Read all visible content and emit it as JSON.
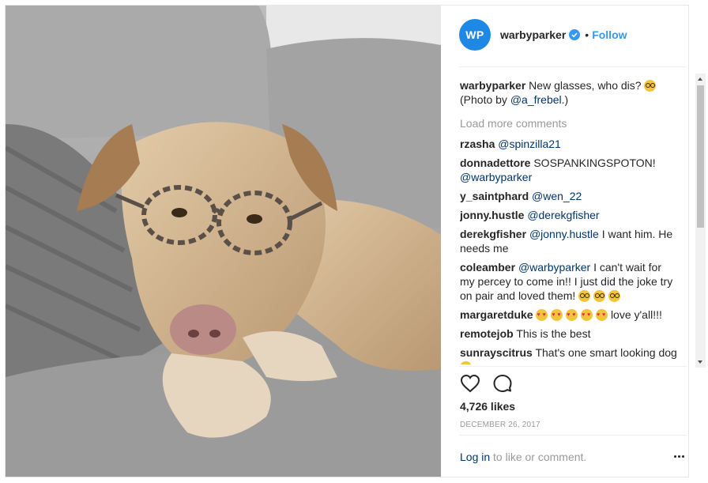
{
  "post": {
    "account": {
      "avatar_text": "WP",
      "username": "warbyparker",
      "verified": true,
      "separator": "•",
      "follow_label": "Follow"
    },
    "caption": {
      "user": "warbyparker",
      "text": "New glasses, who dis?",
      "emoji": "nerd-face",
      "credit_prefix": "(Photo by ",
      "credit_mention": "@a_frebel",
      "credit_suffix": ".)"
    },
    "load_more": "Load more comments",
    "comments": [
      {
        "user": "rzasha",
        "mention": "@spinzilla21",
        "text": ""
      },
      {
        "user": "donnadettore",
        "text": "SOSPANKINGSPOTON!",
        "mention": "@warbyparker"
      },
      {
        "user": "y_saintphard",
        "mention": "@wen_22",
        "text": ""
      },
      {
        "user": "jonny.hustle",
        "mention": "@derekgfisher",
        "text": ""
      },
      {
        "user": "derekgfisher",
        "mention": "@jonny.hustle",
        "text": "I want him. He needs me"
      },
      {
        "user": "coleamber",
        "mention": "@warbyparker",
        "text": "I can't wait for my percey to come in!! I just did the joke try on pair and loved them!",
        "emoji": [
          "nerd-face",
          "nerd-face",
          "nerd-face"
        ]
      },
      {
        "user": "margaretduke",
        "emoji": [
          "heart-eyes",
          "heart-eyes",
          "heart-eyes",
          "heart-eyes",
          "heart-eyes"
        ],
        "text": "love y'all!!!"
      },
      {
        "user": "remotejob",
        "text": "This is the best"
      },
      {
        "user": "sunrayscitrus",
        "text": "That's one smart looking dog",
        "emoji": [
          "grin"
        ]
      }
    ],
    "likes": "4,726 likes",
    "date": "DECEMBER 26, 2017",
    "login_link": "Log in",
    "login_rest": " to like or comment.",
    "icons": {
      "like": "heart-outline-icon",
      "comment": "speech-bubble-icon",
      "more": "more-options-icon",
      "verified": "verified-badge-icon"
    },
    "colors": {
      "accent": "#3897f0",
      "avatar": "#1e88e5",
      "mention": "#003569",
      "muted": "#999999"
    }
  }
}
